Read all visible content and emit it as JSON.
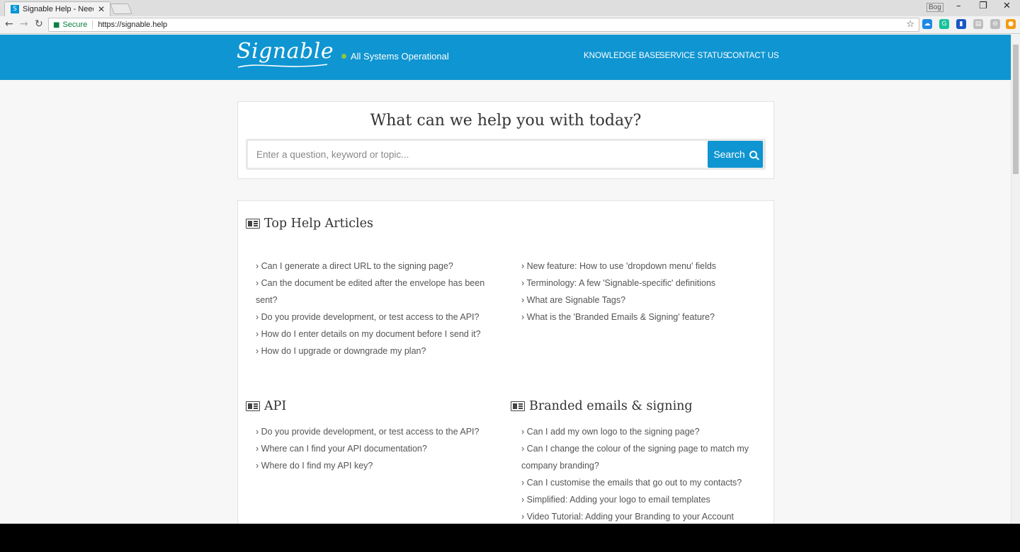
{
  "browser": {
    "tab_title": "Signable Help - Need so",
    "tab_favicon": "S",
    "tab_close": "✕",
    "user_label": "Bog",
    "window_controls": {
      "minimize": "–",
      "restore": "❐",
      "close": "✕"
    },
    "nav": {
      "back": "←",
      "forward": "→",
      "reload": "↻"
    },
    "secure_label": "Secure",
    "url": "https://signable.help",
    "bookmark_star": "☆",
    "extensions": [
      {
        "name": "cloud-extension-icon",
        "color": "#1e88e5",
        "glyph": "☁"
      },
      {
        "name": "grammarly-icon",
        "color": "#15c39a",
        "glyph": "G"
      },
      {
        "name": "bookmark-extension-icon",
        "color": "#1a56c5",
        "glyph": "▮"
      },
      {
        "name": "notes-extension-icon",
        "color": "#bdbdbd",
        "glyph": "▤"
      },
      {
        "name": "print-extension-icon",
        "color": "#bdbdbd",
        "glyph": "⊖"
      },
      {
        "name": "orange-extension-icon",
        "color": "#f39c12",
        "glyph": "●"
      }
    ]
  },
  "header": {
    "logo_text": "Signable",
    "status_text": "All Systems Operational",
    "status_color": "#8cc63f",
    "brand_color": "#0f95d1",
    "nav_links": [
      "KNOWLEDGE BASE",
      "SERVICE STATUS",
      "CONTACT US"
    ]
  },
  "search": {
    "title": "What can we help you with today?",
    "placeholder": "Enter a question, keyword or topic...",
    "button_label": "Search"
  },
  "sections": {
    "top": {
      "title": "Top Help Articles",
      "left": [
        "Can I generate a direct URL to the signing page?",
        "Can the document be edited after the envelope has been sent?",
        "Do you provide development, or test access to the API?",
        "How do I enter details on my document before I send it?",
        "How do I upgrade or downgrade my plan?"
      ],
      "right": [
        "New feature: How to use 'dropdown menu' fields",
        "Terminology: A few 'Signable-specific' definitions",
        "What are Signable Tags?",
        "What is the 'Branded Emails & Signing' feature?"
      ]
    },
    "api": {
      "title": "API",
      "items": [
        "Do you provide development, or test access to the API?",
        "Where can I find your API documentation?",
        "Where do I find my API key?"
      ]
    },
    "branded": {
      "title": "Branded emails & signing",
      "items": [
        "Can I add my own logo to the signing page?",
        "Can I change the colour of the signing page to match my company branding?",
        "Can I customise the emails that go out to my contacts?",
        "Simplified: Adding your logo to email templates",
        "Video Tutorial: Adding your Branding to your Account"
      ]
    }
  }
}
